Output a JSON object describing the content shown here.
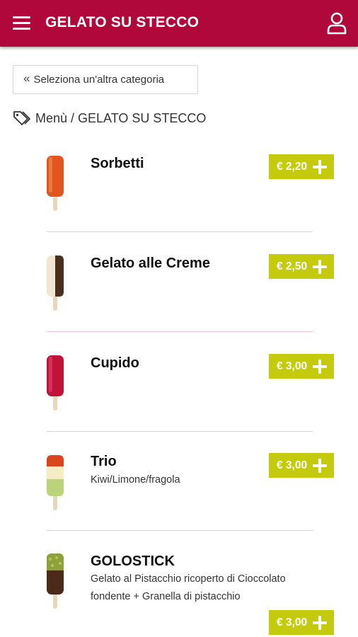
{
  "appbar": {
    "title": "GELATO SU STECCO",
    "menu_icon": "hamburger-menu-icon",
    "user_icon": "user-icon",
    "color": "#b0083a"
  },
  "back_button": {
    "label": "Seleziona un'altra categoria",
    "icon": "double-chevron-left-icon"
  },
  "breadcrumb": {
    "icon": "tags-icon",
    "text": "Menù / GELATO SU STECCO"
  },
  "accent_price_color": "#c3cb0c",
  "items": [
    {
      "name": "Sorbetti",
      "description": "",
      "price": "€ 2,20"
    },
    {
      "name": "Gelato alle Creme",
      "description": "",
      "price": "€ 2,50"
    },
    {
      "name": "Cupido",
      "description": "",
      "price": "€ 3,00"
    },
    {
      "name": "Trio",
      "description": "Kiwi/Limone/fragola",
      "price": "€ 3,00"
    },
    {
      "name": "GOLOSTICK",
      "description": "Gelato al Pistacchio ricoperto di Cioccolato fondente + Granella di pistacchio",
      "price": "€ 3,00"
    }
  ]
}
